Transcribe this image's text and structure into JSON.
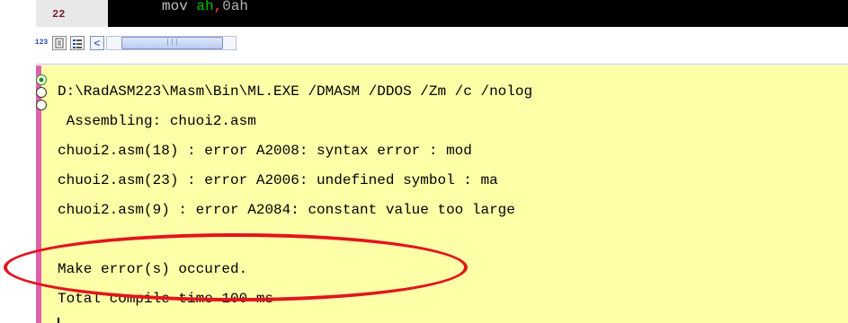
{
  "editor": {
    "line_number": "22",
    "code_kw": "mov ",
    "code_reg": "ah",
    "code_comma": ",",
    "code_num": "0ah"
  },
  "toolbar": {
    "numbers_button": "123",
    "scroll_left_glyph": "<",
    "scroll_thumb_glyph": "|||"
  },
  "output": {
    "lines": [
      "D:\\RadASM223\\Masm\\Bin\\ML.EXE /DMASM /DDOS /Zm /c /nolog",
      " Assembling: chuoi2.asm",
      "chuoi2.asm(18) : error A2008: syntax error : mod",
      "chuoi2.asm(23) : error A2006: undefined symbol : ma",
      "chuoi2.asm(9) : error A2084: constant value too large",
      "",
      "Make error(s) occured.",
      "Total compile time 100 ms"
    ]
  },
  "colors": {
    "output_background": "#ffffa8",
    "highlight_ellipse": "#e0161e",
    "left_edge": "#e060b0"
  }
}
